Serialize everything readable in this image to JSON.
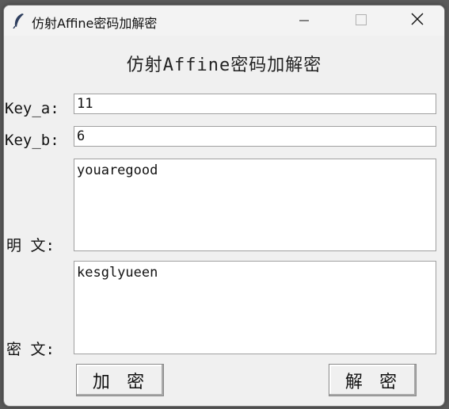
{
  "window": {
    "title": "仿射Affine密码加解密",
    "icon": "feather-icon",
    "controls": [
      "minimize-icon",
      "maximize-icon",
      "close-icon"
    ]
  },
  "header": {
    "title": "仿射Affine密码加解密"
  },
  "form": {
    "key_a": {
      "label": "Key_a:",
      "value": "11"
    },
    "key_b": {
      "label": "Key_b:",
      "value": "6"
    },
    "plaintext": {
      "label": "明 文:",
      "value": "youaregood"
    },
    "ciphertext": {
      "label": "密 文:",
      "value": "kesglyueen"
    }
  },
  "buttons": {
    "encrypt": "加 密",
    "decrypt": "解 密"
  }
}
